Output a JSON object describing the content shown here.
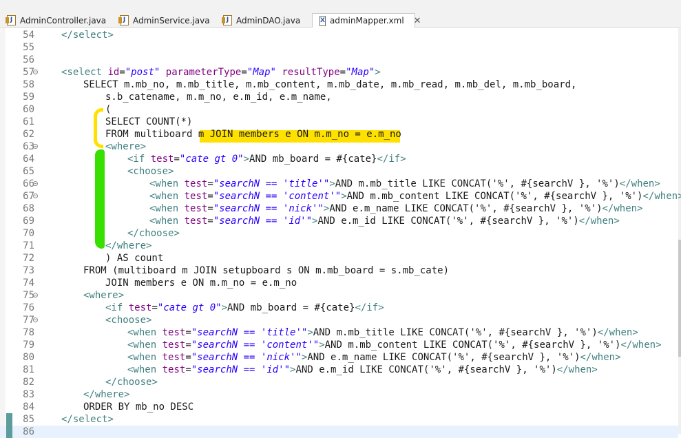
{
  "tabs": [
    {
      "label": "AdminController.java",
      "icon": "java-file-icon"
    },
    {
      "label": "AdminService.java",
      "icon": "java-file-icon"
    },
    {
      "label": "AdminDAO.java",
      "icon": "java-file-icon"
    },
    {
      "label": "adminMapper.xml",
      "icon": "xml-file-icon",
      "active": true,
      "close": "✕"
    }
  ],
  "file_icons": {
    "java": "J",
    "xml": "X"
  },
  "highlight_colors": {
    "yellow": "#ffe100",
    "green": "#38e000",
    "change_bar": "#5c9c9c"
  },
  "lines": [
    {
      "n": "54",
      "text": "</select>"
    },
    {
      "n": "55",
      "text": ""
    },
    {
      "n": "56",
      "text": ""
    },
    {
      "n": "57",
      "text": "<select id=\"post\" parameterType=\"Map\" resultType=\"Map\">"
    },
    {
      "n": "58",
      "text": "SELECT m.mb_no, m.mb_title, m.mb_content, m.mb_date, m.mb_read, m.mb_del, m.mb_board,"
    },
    {
      "n": "59",
      "text": "s.b_catename, m.m_no, e.m_id, e.m_name,"
    },
    {
      "n": "60",
      "text": "("
    },
    {
      "n": "61",
      "text": "SELECT COUNT(*)"
    },
    {
      "n": "62",
      "text": "FROM multiboard m JOIN members e ON m.m_no = e.m_no"
    },
    {
      "n": "63",
      "text": "<where>"
    },
    {
      "n": "64",
      "text": "<if test=\"cate gt 0\">AND mb_board = #{cate}</if>"
    },
    {
      "n": "65",
      "text": "<choose>"
    },
    {
      "n": "66",
      "text": "<when test=\"searchN == 'title'\">AND m.mb_title LIKE CONCAT('%', #{searchV }, '%')</when>"
    },
    {
      "n": "67",
      "text": "<when test=\"searchN == 'content'\">AND m.mb_content LIKE CONCAT('%', #{searchV }, '%')</when>"
    },
    {
      "n": "68",
      "text": "<when test=\"searchN == 'nick'\">AND e.m_name LIKE CONCAT('%', #{searchV }, '%')</when>"
    },
    {
      "n": "69",
      "text": "<when test=\"searchN == 'id'\">AND e.m_id LIKE CONCAT('%', #{searchV }, '%')</when>"
    },
    {
      "n": "70",
      "text": "</choose>"
    },
    {
      "n": "71",
      "text": "</where>"
    },
    {
      "n": "72",
      "text": ") AS count"
    },
    {
      "n": "73",
      "text": "FROM (multiboard m JOIN setupboard s ON m.mb_board = s.mb_cate)"
    },
    {
      "n": "74",
      "text": "JOIN members e ON m.m_no = e.m_no"
    },
    {
      "n": "75",
      "text": "<where>"
    },
    {
      "n": "76",
      "text": "<if test=\"cate gt 0\">AND mb_board = #{cate}</if>"
    },
    {
      "n": "77",
      "text": "<choose>"
    },
    {
      "n": "78",
      "text": "<when test=\"searchN == 'title'\">AND m.mb_title LIKE CONCAT('%', #{searchV }, '%')</when>"
    },
    {
      "n": "79",
      "text": "<when test=\"searchN == 'content'\">AND m.mb_content LIKE CONCAT('%', #{searchV }, '%')</when>"
    },
    {
      "n": "80",
      "text": "<when test=\"searchN == 'nick'\">AND e.m_name LIKE CONCAT('%', #{searchV }, '%')</when>"
    },
    {
      "n": "81",
      "text": "<when test=\"searchN == 'id'\">AND e.m_id LIKE CONCAT('%', #{searchV }, '%')</when>"
    },
    {
      "n": "82",
      "text": "</choose>"
    },
    {
      "n": "83",
      "text": "</where>"
    },
    {
      "n": "84",
      "text": "ORDER BY mb_no DESC"
    },
    {
      "n": "85",
      "text": "</select>"
    },
    {
      "n": "86",
      "text": ""
    }
  ]
}
